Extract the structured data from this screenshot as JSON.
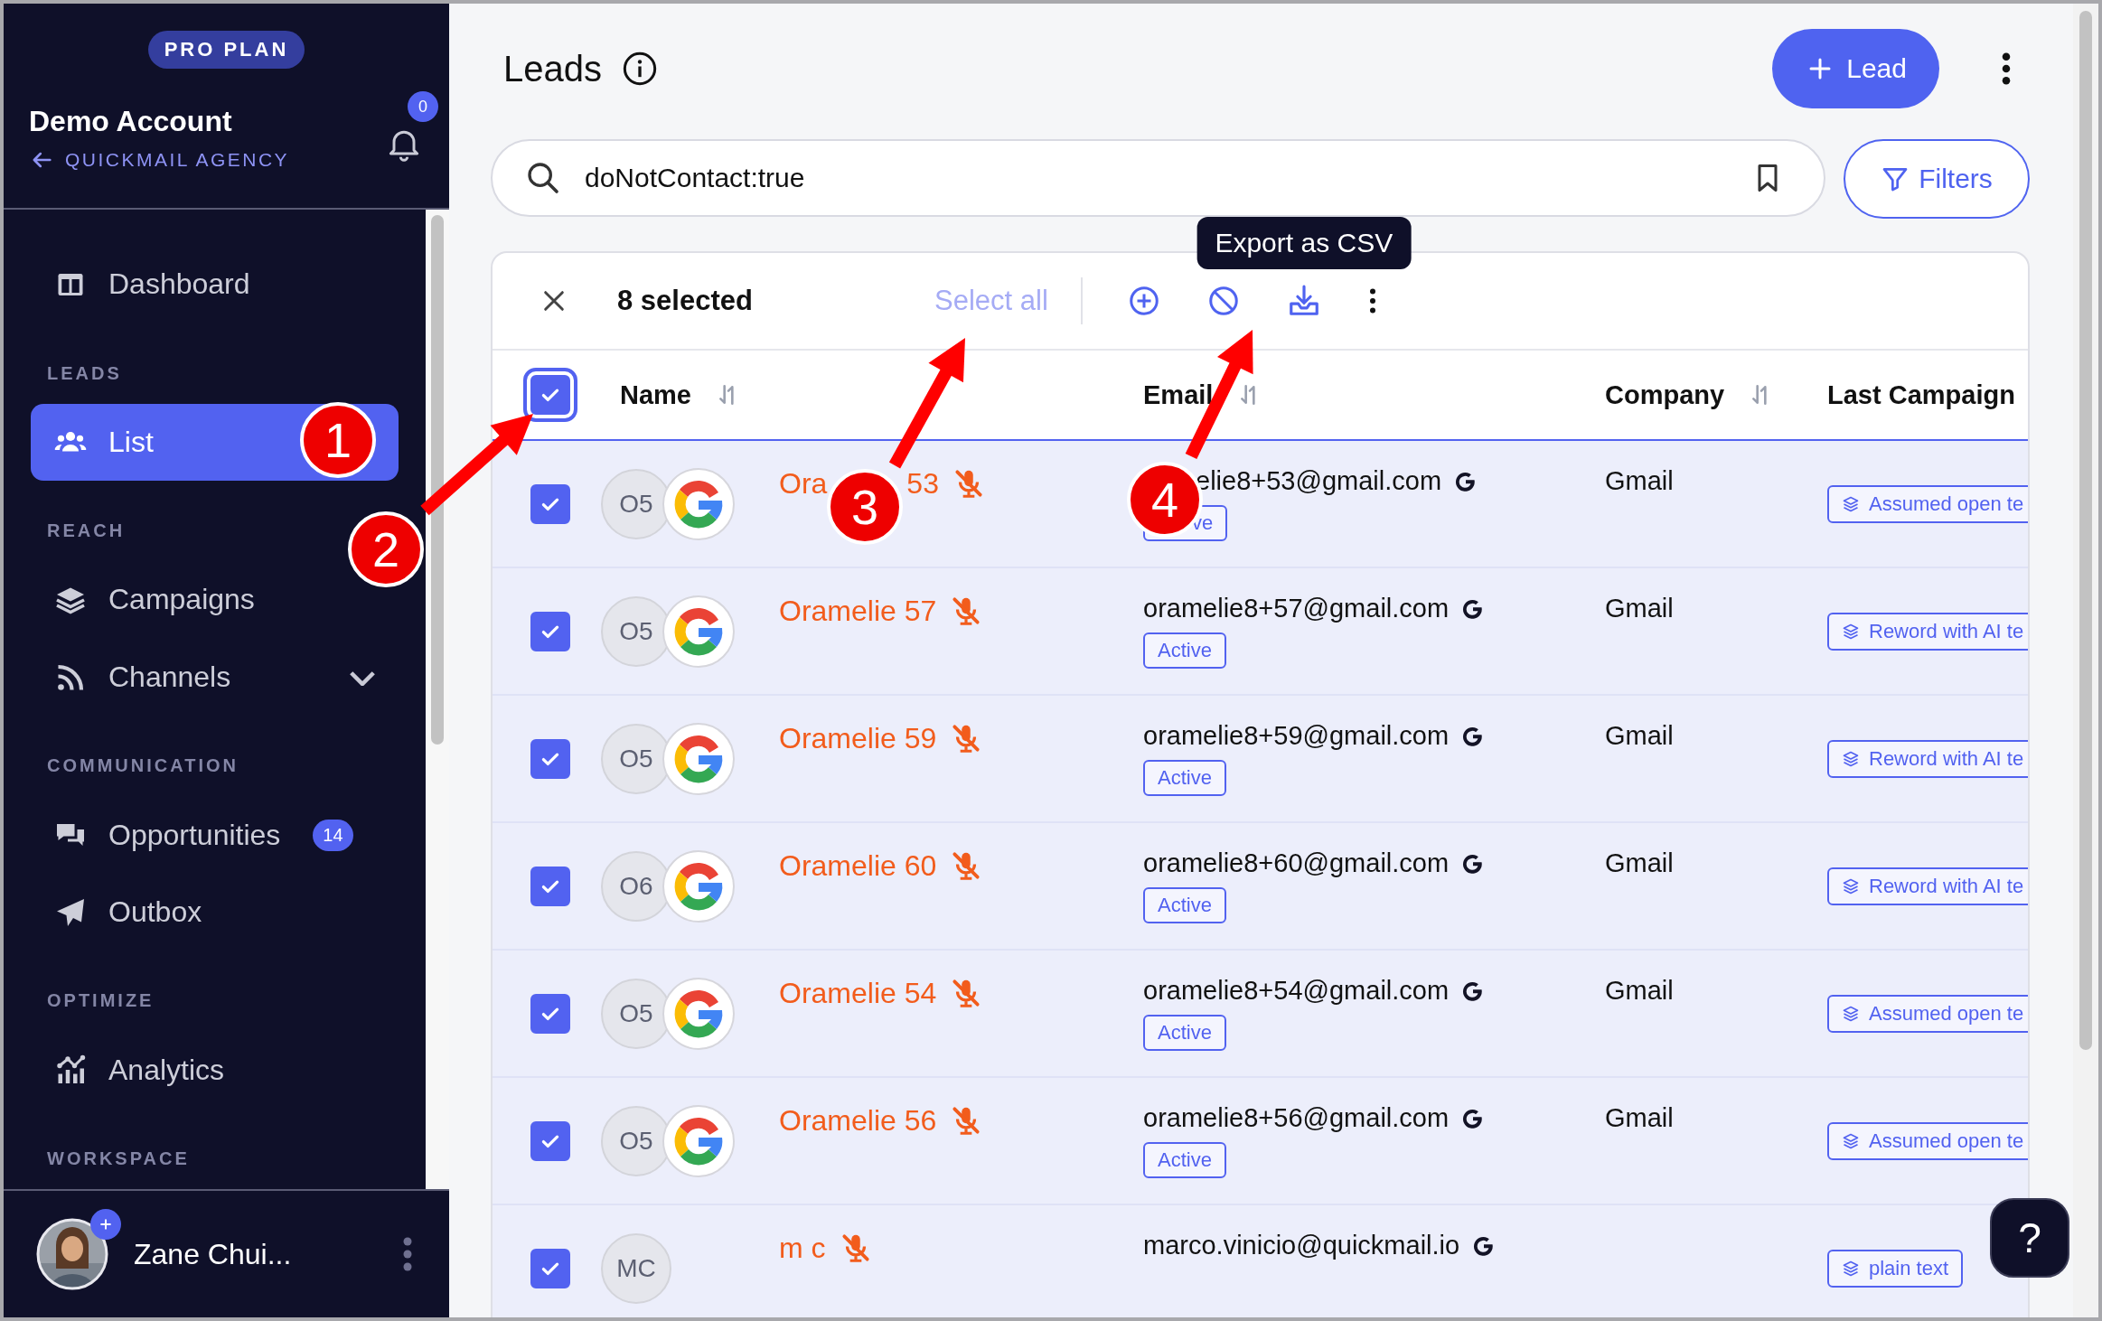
{
  "sidebar": {
    "plan_badge": "PRO PLAN",
    "account": {
      "name": "Demo Account",
      "parent": "QUICKMAIL AGENCY",
      "notification_count": "0"
    },
    "nav": [
      {
        "kind": "item",
        "label": "Dashboard",
        "selected": false
      },
      {
        "kind": "section",
        "label": "LEADS"
      },
      {
        "kind": "item",
        "label": "List",
        "selected": true
      },
      {
        "kind": "section",
        "label": "REACH"
      },
      {
        "kind": "item",
        "label": "Campaigns",
        "selected": false
      },
      {
        "kind": "item",
        "label": "Channels",
        "selected": false,
        "expanded": false
      },
      {
        "kind": "section",
        "label": "COMMUNICATION"
      },
      {
        "kind": "item",
        "label": "Opportunities",
        "selected": false,
        "badge": "14"
      },
      {
        "kind": "item",
        "label": "Outbox",
        "selected": false
      },
      {
        "kind": "section",
        "label": "OPTIMIZE"
      },
      {
        "kind": "item",
        "label": "Analytics",
        "selected": false
      },
      {
        "kind": "section",
        "label": "WORKSPACE"
      }
    ],
    "user": {
      "name": "Zane Chui..."
    }
  },
  "header": {
    "title": "Leads",
    "add_button": "Lead"
  },
  "search": {
    "value": "doNotContact:true"
  },
  "filters_button": "Filters",
  "selection_bar": {
    "count": "8 selected",
    "select_all": "Select all",
    "tooltip": "Export as CSV"
  },
  "table": {
    "header_checked": true,
    "columns": [
      {
        "label": "Name",
        "sortable": true
      },
      {
        "label": "Email",
        "sortable": true
      },
      {
        "label": "Company",
        "sortable": true
      },
      {
        "label": "Last Campaign",
        "sortable": false
      }
    ],
    "rows": [
      {
        "kind": "covered",
        "checked": true,
        "initials": "O5",
        "google": true,
        "name_fragments": [
          "Ora",
          "53"
        ],
        "email": "elie8+53@gmail.com",
        "status": "ve",
        "company": "Gmail",
        "campaign": "Assumed open te"
      },
      {
        "checked": true,
        "initials": "O5",
        "google": true,
        "name": "Oramelie 57",
        "email": "oramelie8+57@gmail.com",
        "status": "Active",
        "company": "Gmail",
        "campaign": "Reword with AI te"
      },
      {
        "checked": true,
        "initials": "O5",
        "google": true,
        "name": "Oramelie 59",
        "email": "oramelie8+59@gmail.com",
        "status": "Active",
        "company": "Gmail",
        "campaign": "Reword with AI te"
      },
      {
        "checked": true,
        "initials": "O6",
        "google": true,
        "name": "Oramelie 60",
        "email": "oramelie8+60@gmail.com",
        "status": "Active",
        "company": "Gmail",
        "campaign": "Reword with AI te"
      },
      {
        "checked": true,
        "initials": "O5",
        "google": true,
        "name": "Oramelie 54",
        "email": "oramelie8+54@gmail.com",
        "status": "Active",
        "company": "Gmail",
        "campaign": "Assumed open te"
      },
      {
        "checked": true,
        "initials": "O5",
        "google": true,
        "name": "Oramelie 56",
        "email": "oramelie8+56@gmail.com",
        "status": "Active",
        "company": "Gmail",
        "campaign": "Assumed open te"
      },
      {
        "checked": true,
        "initials": "MC",
        "google": false,
        "name": "m c",
        "email": "marco.vinicio@quickmail.io",
        "campaign": "plain text"
      }
    ]
  },
  "help_button": "?",
  "annotations": [
    "1",
    "2",
    "3",
    "4"
  ]
}
